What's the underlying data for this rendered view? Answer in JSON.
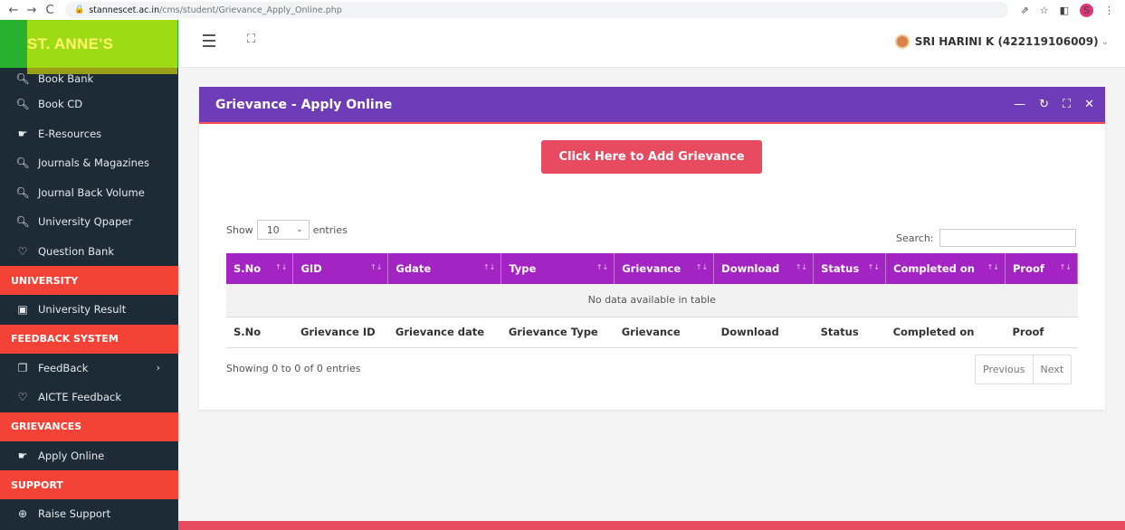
{
  "browser": {
    "url_domain": "stannescet.ac.in",
    "url_path": "/cms/student/Grievance_Apply_Online.php",
    "profile_initial": "S"
  },
  "brand": {
    "name": "ST. ANNE'S"
  },
  "header": {
    "user": "SRI HARINI K (422119106009)"
  },
  "sidebar": {
    "items_top": [
      {
        "label": "Book Bank",
        "icon": "search-icon"
      },
      {
        "label": "Book CD",
        "icon": "search-icon"
      },
      {
        "label": "E-Resources",
        "icon": "hand-icon"
      },
      {
        "label": "Journals & Magazines",
        "icon": "search-icon"
      },
      {
        "label": "Journal Back Volume",
        "icon": "search-icon"
      },
      {
        "label": "University Qpaper",
        "icon": "search-icon"
      },
      {
        "label": "Question Bank",
        "icon": "bulb-icon"
      }
    ],
    "section_university": "UNIVERSITY",
    "university_result": "University Result",
    "section_feedback": "FEEDBACK SYSTEM",
    "feedback": "FeedBack",
    "aicte_feedback": "AICTE Feedback",
    "section_grievances": "GRIEVANCES",
    "apply_online": "Apply Online",
    "section_support": "SUPPORT",
    "raise_support": "Raise Support"
  },
  "card": {
    "title": "Grievance - Apply Online",
    "add_button": "Click Here to Add Grievance",
    "show_label": "Show",
    "show_value": "10",
    "entries_label": "entries",
    "search_label": "Search:",
    "columns": [
      "S.No",
      "GID",
      "Gdate",
      "Type",
      "Grievance",
      "Download",
      "Status",
      "Completed on",
      "Proof"
    ],
    "empty_message": "No data available in table",
    "footer_columns": [
      "S.No",
      "Grievance ID",
      "Grievance date",
      "Grievance Type",
      "Grievance",
      "Download",
      "Status",
      "Completed on",
      "Proof"
    ],
    "info": "Showing 0 to 0 of 0 entries",
    "prev": "Previous",
    "next": "Next"
  },
  "colors": {
    "sidebar_bg": "#1c2b36",
    "section_red": "#f44336",
    "card_header": "#6f3cb8",
    "table_header": "#a323c3",
    "button": "#e84a5f"
  }
}
